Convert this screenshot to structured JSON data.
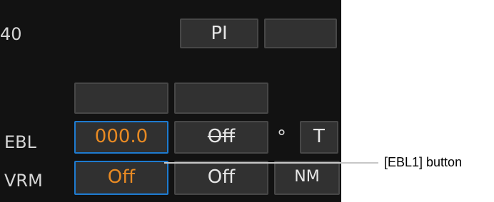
{
  "top_row": {
    "range_value": "40",
    "pi_label": "PI",
    "blank_label": ""
  },
  "mid_row": {
    "btn1_label": "",
    "btn2_label": ""
  },
  "ebl": {
    "label": "EBL",
    "ebl1_value": "000.0",
    "ebl2_value": "Off",
    "unit_symbol": "°",
    "ref_label": "T"
  },
  "vrm": {
    "label": "VRM",
    "vrm1_value": "Off",
    "vrm2_value": "Off",
    "unit_label": "NM"
  },
  "callout": {
    "text": "[EBL1] button"
  },
  "colors": {
    "panel_bg": "#121212",
    "button_bg": "#313131",
    "selected_border": "#1e7bd0",
    "value_orange": "#e88a23"
  }
}
